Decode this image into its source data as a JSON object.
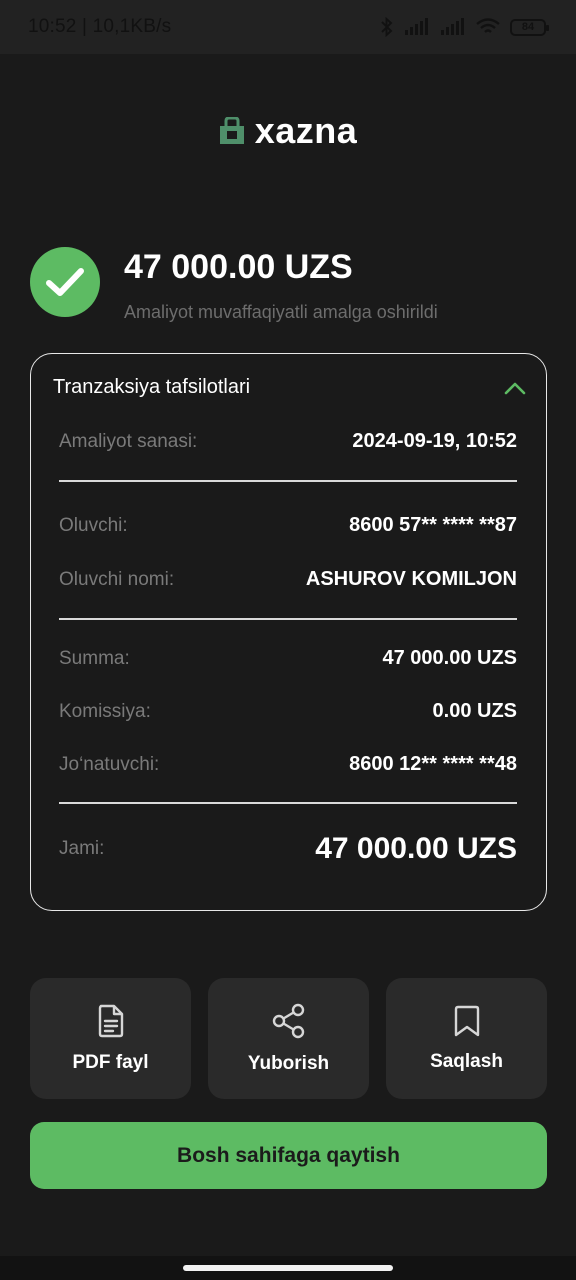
{
  "status_bar": {
    "time_speed": "10:52 | 10,1KB/s",
    "battery": "84"
  },
  "logo": {
    "text": "xazna",
    "icon": "lock-bag-icon",
    "icon_color": "#4f8f6a"
  },
  "summary": {
    "amount": "47 000.00 UZS",
    "message": "Amaliyot muvaffaqiyatli amalga oshirildi",
    "status_icon": "checkmark-icon",
    "accent_color": "#5dbb63"
  },
  "details": {
    "title": "Tranzaksiya tafsilotlari",
    "collapse_icon": "chevron-up-icon",
    "date": {
      "label": "Amaliyot sanasi:",
      "value": "2024-09-19, 10:52"
    },
    "recipient": {
      "label": "Oluvchi:",
      "value": "8600 57** **** **87"
    },
    "recipient_name": {
      "label": "Oluvchi nomi:",
      "value": "ASHUROV KOMILJON"
    },
    "sum": {
      "label": "Summa:",
      "value": "47 000.00 UZS"
    },
    "commission": {
      "label": "Komissiya:",
      "value": "0.00 UZS"
    },
    "sender": {
      "label": "Jo‘natuvchi:",
      "value": "8600 12** **** **48"
    },
    "total": {
      "label": "Jami:",
      "value": "47 000.00 UZS"
    }
  },
  "actions": {
    "pdf": {
      "label": "PDF fayl",
      "icon": "document-icon"
    },
    "share": {
      "label": "Yuborish",
      "icon": "share-icon"
    },
    "save": {
      "label": "Saqlash",
      "icon": "bookmark-icon"
    }
  },
  "home_button": {
    "label": "Bosh sahifaga qaytish"
  }
}
